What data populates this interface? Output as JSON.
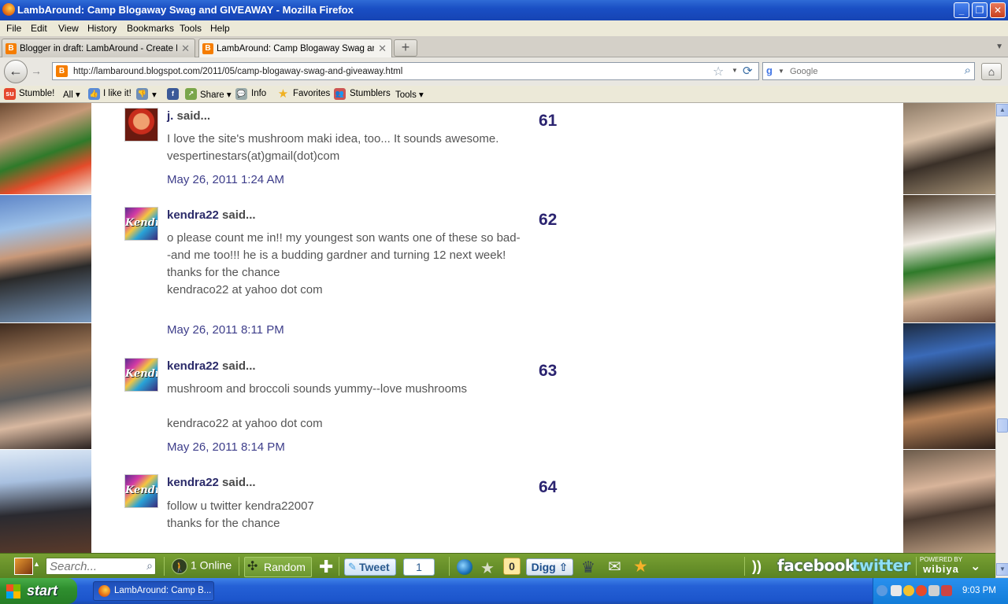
{
  "window": {
    "title": "LambAround: Camp Blogaway Swag and GIVEAWAY - Mozilla Firefox",
    "controls": {
      "minimize": "_",
      "maximize": "❐",
      "close": "✕"
    }
  },
  "menu": [
    "File",
    "Edit",
    "View",
    "History",
    "Bookmarks",
    "Tools",
    "Help"
  ],
  "tabs": [
    {
      "label": "Blogger in draft: LambAround - Create P...",
      "active": false
    },
    {
      "label": "LambAround: Camp Blogaway Swag and ...",
      "active": true
    }
  ],
  "navigation": {
    "url": "http://lambaround.blogspot.com/2011/05/camp-blogaway-swag-and-giveaway.html",
    "search_placeholder": "Google"
  },
  "stumble_toolbar": {
    "stumble": "Stumble!",
    "all": "All",
    "ilike": "I like it!",
    "share": "Share",
    "info": "Info",
    "favorites": "Favorites",
    "stumblers": "Stumblers",
    "tools": "Tools"
  },
  "comments": [
    {
      "number": "61",
      "author": "j.",
      "said": " said...",
      "avatar": "red-hat-avatar",
      "body": "I love the site's mushroom maki idea, too... It sounds awesome.\nvespertinestars(at)gmail(dot)com",
      "timestamp": "May 26, 2011 1:24 AM"
    },
    {
      "number": "62",
      "author": "kendra22",
      "said": " said...",
      "avatar": "kendra-graffiti-avatar",
      "body": "o please count me in!! my youngest son wants one of these so bad--and me too!!! he is a budding gardner and turning 12 next week!\nthanks for the chance\nkendraco22 at yahoo dot com",
      "timestamp": "May 26, 2011 8:11 PM"
    },
    {
      "number": "63",
      "author": "kendra22",
      "said": " said...",
      "avatar": "kendra-graffiti-avatar",
      "body": "mushroom and broccoli sounds yummy--love mushrooms\n\nkendraco22 at yahoo dot com",
      "timestamp": "May 26, 2011 8:14 PM"
    },
    {
      "number": "64",
      "author": "kendra22",
      "said": " said...",
      "avatar": "kendra-graffiti-avatar",
      "body": "follow u twitter kendra22007\nthanks for the chance",
      "timestamp": ""
    }
  ],
  "avatar_text": "Kendra",
  "wibiya": {
    "search_placeholder": "Search...",
    "online": "1 Online",
    "random": "Random",
    "tweet": "Tweet",
    "tweet_count": "1",
    "rate_count": "0",
    "digg": "Digg",
    "facebook": "facebook",
    "twitter": "twitter",
    "powered_by": "POWERED BY",
    "brand": "wibiya"
  },
  "taskbar": {
    "start": "start",
    "item": "LambAround: Camp B...",
    "clock": "9:03 PM"
  },
  "colors": {
    "link": "#2b2b6a",
    "timestamp": "#3d3d8a",
    "number": "#2b2470",
    "wibiya_green": "#6b9530"
  }
}
